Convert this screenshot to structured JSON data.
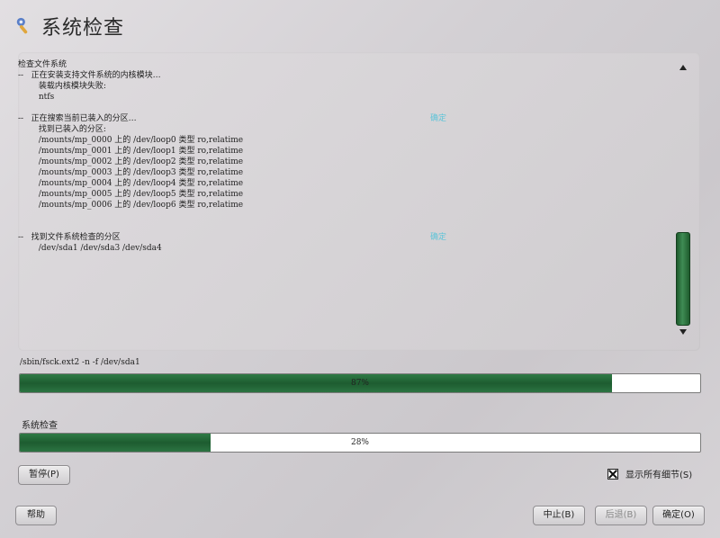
{
  "window": {
    "title": "系统检查",
    "icon": "wrench-icon"
  },
  "log": {
    "groups": [
      {
        "lines": [
          {
            "text": "检查文件系统",
            "status": ""
          },
          {
            "text": "--   正在安装支持文件系统的内核模块…",
            "status": ""
          },
          {
            "text": "        装载内核模块失败:",
            "status": ""
          },
          {
            "text": "        ntfs",
            "status": ""
          }
        ]
      },
      {
        "lines": [
          {
            "text": "--   正在搜索当前已装入的分区…",
            "status": "确定"
          },
          {
            "text": "        找到已装入的分区:",
            "status": ""
          },
          {
            "text": "        /mounts/mp_0000 上的 /dev/loop0 类型 ro,relatime",
            "status": ""
          },
          {
            "text": "        /mounts/mp_0001 上的 /dev/loop1 类型 ro,relatime",
            "status": ""
          },
          {
            "text": "        /mounts/mp_0002 上的 /dev/loop2 类型 ro,relatime",
            "status": ""
          },
          {
            "text": "        /mounts/mp_0003 上的 /dev/loop3 类型 ro,relatime",
            "status": ""
          },
          {
            "text": "        /mounts/mp_0004 上的 /dev/loop4 类型 ro,relatime",
            "status": ""
          },
          {
            "text": "        /mounts/mp_0005 上的 /dev/loop5 类型 ro,relatime",
            "status": ""
          },
          {
            "text": "        /mounts/mp_0006 上的 /dev/loop6 类型 ro,relatime",
            "status": ""
          }
        ]
      },
      {
        "lines": [
          {
            "text": "--   找到文件系统检查的分区",
            "status": "确定"
          },
          {
            "text": "        /dev/sda1 /dev/sda3 /dev/sda4",
            "status": ""
          }
        ]
      }
    ]
  },
  "current_command": "/sbin/fsck.ext2 -n -f /dev/sda1",
  "progress_command": {
    "value": 87,
    "label": "87%"
  },
  "section_label": "系统检查",
  "progress_overall": {
    "value": 28,
    "label": "28%"
  },
  "buttons": {
    "pause": "暂停(P)",
    "help": "帮助",
    "abort": "中止(B)",
    "back": "后退(B)",
    "ok": "确定(O)"
  },
  "show_details": {
    "label": "显示所有细节(S)",
    "checked": true
  },
  "colors": {
    "progress_fill": "#1d5c30",
    "status_ok": "#5dc4d8"
  }
}
